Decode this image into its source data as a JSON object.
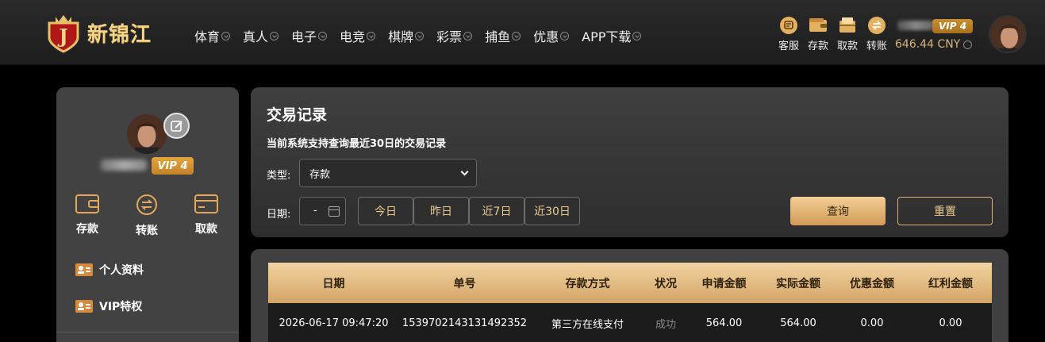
{
  "header": {
    "brand": "新锦江",
    "nav": [
      {
        "label": "体育"
      },
      {
        "label": "真人"
      },
      {
        "label": "电子"
      },
      {
        "label": "电竞"
      },
      {
        "label": "棋牌"
      },
      {
        "label": "彩票"
      },
      {
        "label": "捕鱼"
      },
      {
        "label": "优惠"
      },
      {
        "label": "APP下载"
      }
    ],
    "quick": [
      {
        "label": "客服",
        "icon": "chat-icon"
      },
      {
        "label": "存款",
        "icon": "wallet-icon"
      },
      {
        "label": "取款",
        "icon": "withdraw-icon"
      },
      {
        "label": "转账",
        "icon": "transfer-icon"
      }
    ],
    "vip": "VIP 4",
    "balance": "646.44 CNY"
  },
  "sidebar": {
    "vip": "VIP 4",
    "actions": [
      {
        "label": "存款",
        "icon": "wallet-icon"
      },
      {
        "label": "转账",
        "icon": "transfer-icon"
      },
      {
        "label": "取款",
        "icon": "card-icon"
      }
    ],
    "menu": [
      {
        "label": "个人资料",
        "icon": "id-card-icon"
      },
      {
        "label": "VIP特权",
        "icon": "vip-card-icon"
      }
    ]
  },
  "filter": {
    "title": "交易记录",
    "subtitle": "当前系统支持查询最近30日的交易记录",
    "type_label": "类型:",
    "type_value": "存款",
    "date_label": "日期:",
    "date_value": "-",
    "ranges": [
      "今日",
      "昨日",
      "近7日",
      "近30日"
    ],
    "query_label": "查询",
    "reset_label": "重置"
  },
  "table": {
    "headers": [
      "日期",
      "单号",
      "存款方式",
      "状况",
      "申请金额",
      "实际金额",
      "优惠金额",
      "红利金额"
    ],
    "rows": [
      [
        "2026-06-17 09:47:20",
        "1539702143131492352",
        "第三方在线支付",
        "成功",
        "564.00",
        "564.00",
        "0.00",
        "0.00"
      ]
    ]
  },
  "colors": {
    "accent_gold": "#d19a55",
    "vip_orange": "#e4a53c"
  }
}
